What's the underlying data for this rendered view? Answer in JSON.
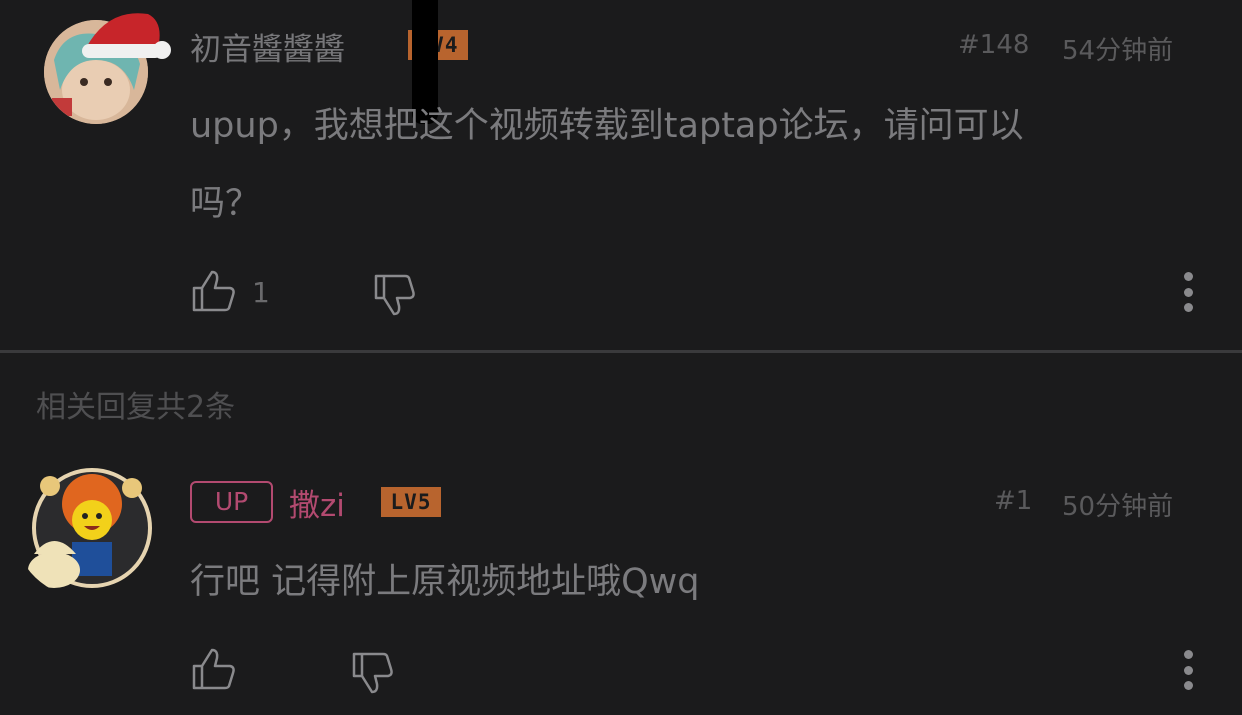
{
  "comments": [
    {
      "username": "初音醬醬醬",
      "level": "LV4",
      "floor": "#148",
      "time": "54分钟前",
      "content_line1": "upup，我想把这个视频转载到taptap论坛，请问可以",
      "content_line2": "吗？",
      "likes": "1"
    }
  ],
  "replies_section": {
    "title": "相关回复共2条",
    "reply": {
      "up_badge": "UP",
      "username": "撒zi",
      "level": "LV5",
      "floor": "#1",
      "time": "50分钟前",
      "content": "行吧 记得附上原视频地址哦Qwq"
    }
  },
  "icons": {
    "like": "thumbs-up-icon",
    "dislike": "thumbs-down-icon",
    "more": "more-vertical-icon"
  },
  "colors": {
    "background": "#1b1b1c",
    "up_accent": "#b34a70",
    "level_badge": "#b8642e"
  }
}
